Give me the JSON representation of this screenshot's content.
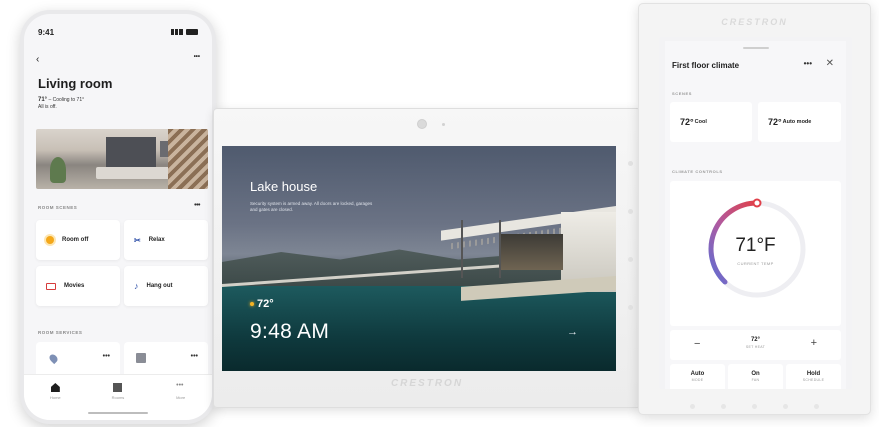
{
  "phone": {
    "status_time": "9:41",
    "back_glyph": "‹",
    "more_glyph": "•••",
    "title": "Living room",
    "status_temp": "71°",
    "status_text": " – Cooling to 71°",
    "status_line2": "All is off.",
    "scenes_label": "ROOM SCENES",
    "scenes_more": "•••",
    "scenes": [
      {
        "label": "Room off",
        "icon": "sun-icon"
      },
      {
        "label": "Relax",
        "icon": "relax-icon"
      },
      {
        "label": "Movies",
        "icon": "tv-icon"
      },
      {
        "label": "Hang out",
        "icon": "music-note-icon"
      }
    ],
    "services_label": "ROOM SERVICES",
    "service_more": "•••",
    "tabs": [
      {
        "label": "Home",
        "icon": "home-icon"
      },
      {
        "label": "Rooms",
        "icon": "rooms-icon"
      },
      {
        "label": "More",
        "icon": "more-icon"
      }
    ]
  },
  "panel": {
    "title": "Lake house",
    "description": "Security system is armed away. All doors are locked, garages and gates are closed.",
    "temperature": "72°",
    "time": "9:48 AM",
    "arrow": "→",
    "brand": "CRESTRON"
  },
  "tablet": {
    "brand": "CRESTRON",
    "title": "First floor climate",
    "more_glyph": "•••",
    "close_glyph": "✕",
    "scenes_label": "SCENES",
    "scenes": [
      {
        "temp": "72°",
        "word": "Cool"
      },
      {
        "temp": "72°",
        "word": "Auto mode"
      }
    ],
    "controls_label": "CLIMATE CONTROLS",
    "current_temp": "71°F",
    "current_label": "CURRENT TEMP",
    "minus": "−",
    "plus": "+",
    "set_value": "72°",
    "set_label": "SET HEAT",
    "modes": [
      {
        "value": "Auto",
        "label": "MODE"
      },
      {
        "value": "On",
        "label": "FAN"
      },
      {
        "value": "Hold",
        "label": "SCHEDULE"
      }
    ]
  },
  "colors": {
    "accent_gradient_start": "#e0404a",
    "accent_gradient_end": "#5a6fd6",
    "sun": "#f4a81a",
    "tv": "#d63c3c",
    "icon_blue": "#2d4fa8"
  }
}
